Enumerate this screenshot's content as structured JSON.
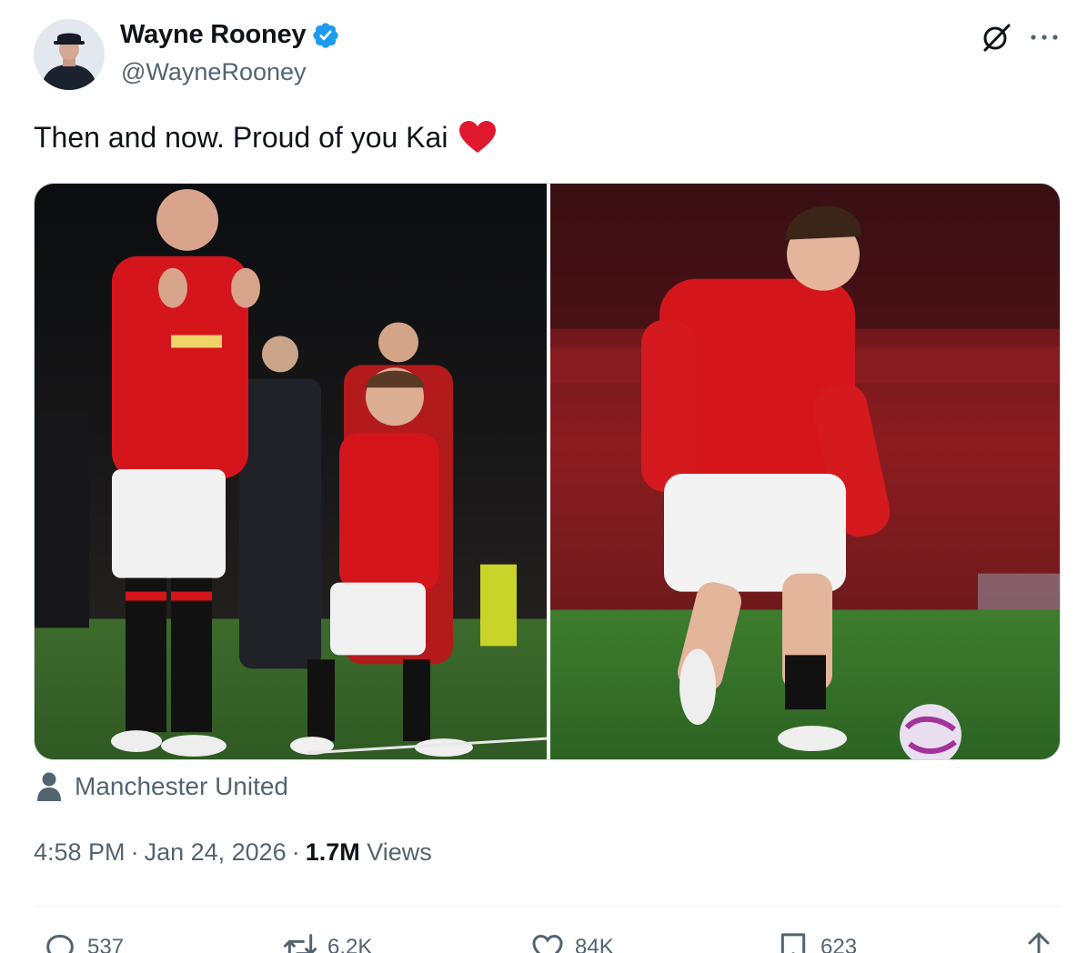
{
  "author": {
    "display_name": "Wayne Rooney",
    "handle": "@WayneRooney",
    "verified": true,
    "verified_color": "#1d9bf0"
  },
  "header_icons": [
    "grok-icon",
    "more-options-icon"
  ],
  "tweet": {
    "text": "Then and now. Proud of you Kai",
    "emoji": "heart-emoji",
    "heart_color": "#e0182e"
  },
  "media": {
    "photos": [
      "photo-then-old-trafford",
      "photo-now-playing"
    ]
  },
  "location": {
    "icon": "person-icon",
    "label": "Manchester United"
  },
  "meta": {
    "time": "4:58 PM",
    "separator": "·",
    "date": "Jan 24, 2026",
    "views_count": "1.7M",
    "views_label": "Views"
  },
  "actions": {
    "reply_count": "537",
    "retweet_count": "6.2K",
    "like_count": "84K",
    "bookmark_count": "623"
  },
  "colors": {
    "text_primary": "#0f1419",
    "text_secondary": "#536471",
    "united_red": "#d4151c"
  }
}
